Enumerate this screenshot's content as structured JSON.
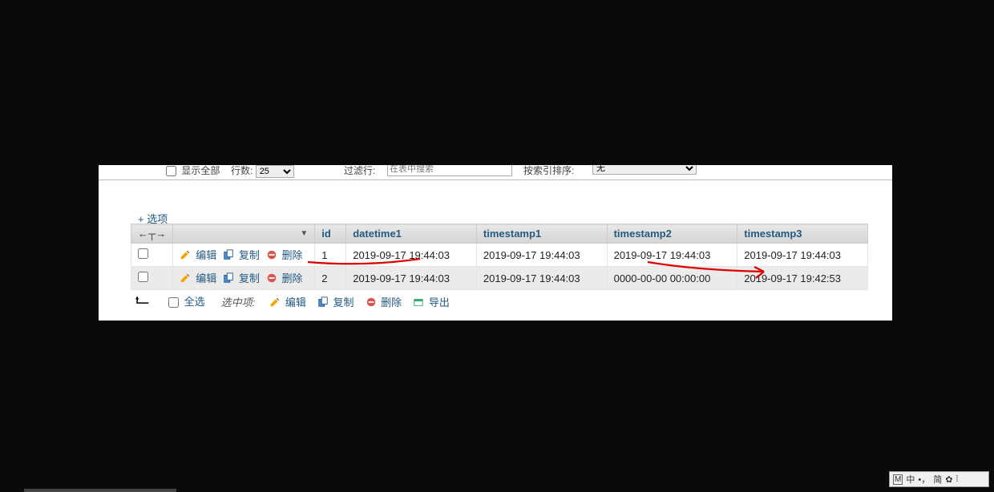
{
  "topbar": {
    "show_all": "显示全部",
    "row_label": "行数:",
    "row_value": "25",
    "filter_label": "过滤行:",
    "filter_placeholder": "在表中搜索",
    "byindex_label": "按索引排序:",
    "byindex_value": "无"
  },
  "options_link": "+ 选项",
  "arrows_label": "←┬→",
  "columns": [
    "id",
    "datetime1",
    "timestamp1",
    "timestamp2",
    "timestamp3"
  ],
  "row_actions": {
    "edit": "编辑",
    "copy": "复制",
    "delete": "删除"
  },
  "rows": [
    {
      "id": "1",
      "datetime1": "2019-09-17 19:44:03",
      "timestamp1": "2019-09-17 19:44:03",
      "timestamp2": "2019-09-17 19:44:03",
      "timestamp3": "2019-09-17 19:44:03"
    },
    {
      "id": "2",
      "datetime1": "2019-09-17 19:44:03",
      "timestamp1": "2019-09-17 19:44:03",
      "timestamp2": "0000-00-00 00:00:00",
      "timestamp3": "2019-09-17 19:42:53"
    }
  ],
  "footer": {
    "select_all": "全选",
    "selected_label": "选中项:",
    "edit": "编辑",
    "copy": "复制",
    "delete": "删除",
    "export": "导出"
  },
  "ime": {
    "m": "M",
    "zhong": "中",
    "jian": "简"
  }
}
